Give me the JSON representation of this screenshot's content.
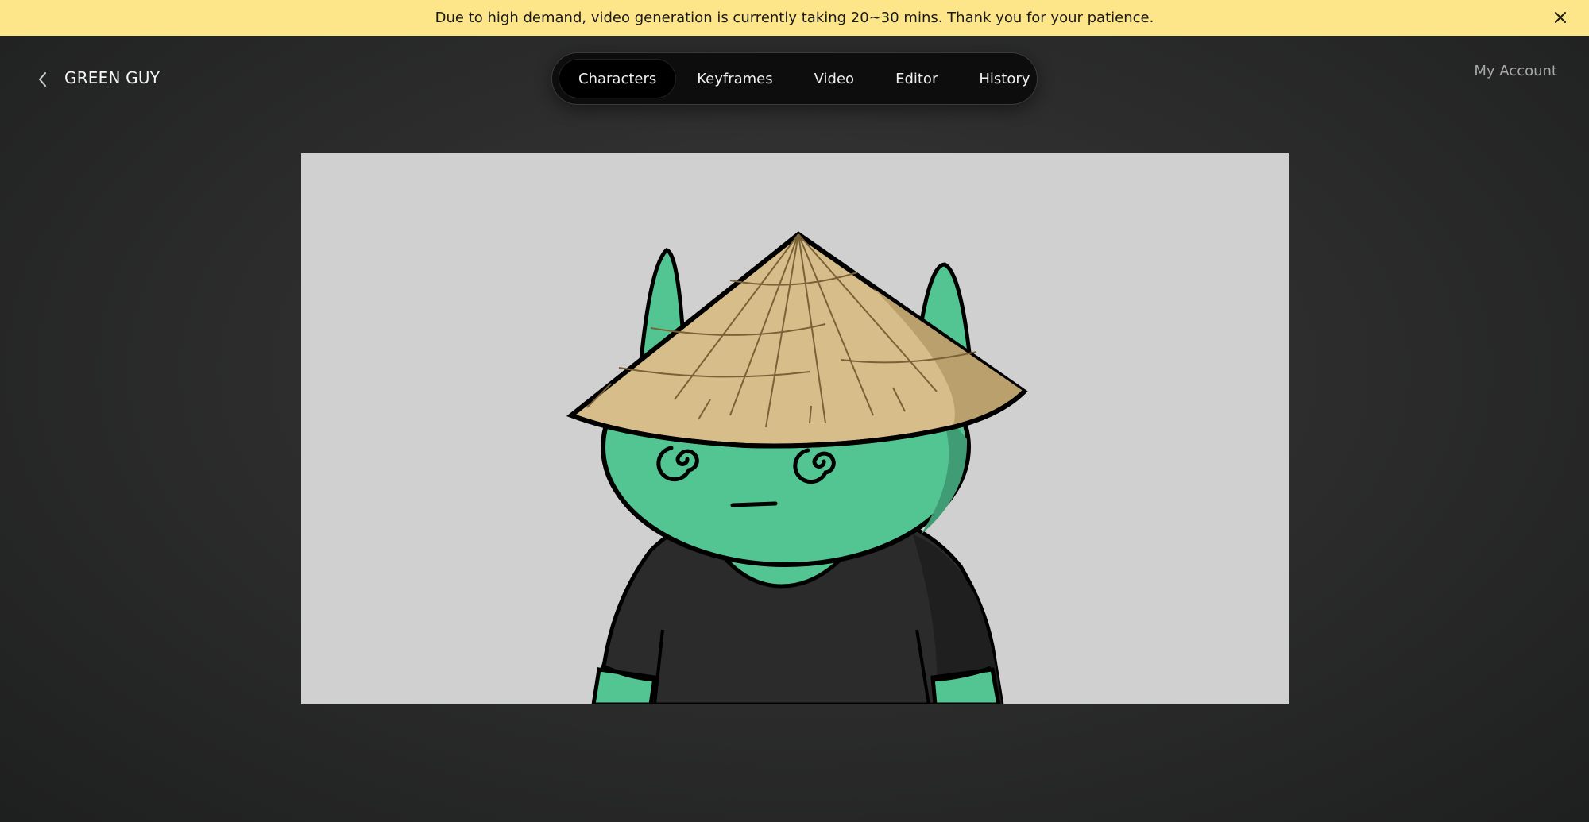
{
  "banner": {
    "message": "Due to high demand, video generation is currently taking 20~30 mins. Thank you for your patience.",
    "close_icon": "close-icon",
    "color": "#fde68a"
  },
  "header": {
    "back_icon": "chevron-left-icon",
    "project_title": "GREEN GUY",
    "account_label": "My Account"
  },
  "nav": {
    "tabs": [
      {
        "label": "Characters",
        "active": true
      },
      {
        "label": "Keyframes",
        "active": false
      },
      {
        "label": "Video",
        "active": false
      },
      {
        "label": "Editor",
        "active": false
      },
      {
        "label": "History",
        "active": false
      }
    ]
  },
  "canvas": {
    "image_subject": "green character wearing conical straw hat and black t-shirt",
    "background_color": "#d0d0d0",
    "skin_color": "#52c592",
    "hat_color": "#d6bd8a",
    "shirt_color": "#2b2b2b"
  }
}
